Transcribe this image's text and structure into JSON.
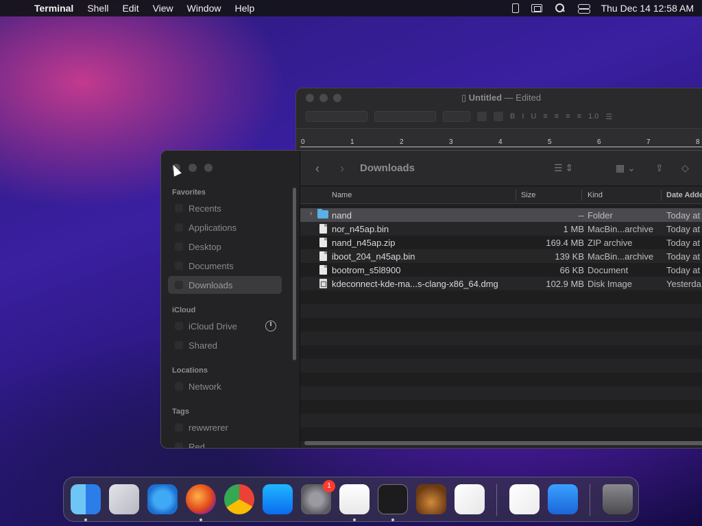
{
  "menubar": {
    "app_name": "Terminal",
    "items": [
      "Shell",
      "Edit",
      "View",
      "Window",
      "Help"
    ],
    "datetime": "Thu Dec 14  12:58 AM"
  },
  "textedit": {
    "title": "Untitled",
    "title_suffix": "— Edited",
    "line_spacing": "1.0",
    "ruler_numbers": [
      "0",
      "1",
      "2",
      "3",
      "4",
      "5",
      "6",
      "7",
      "8"
    ]
  },
  "finder": {
    "title": "Downloads",
    "sidebar": {
      "favorites_heading": "Favorites",
      "favorites": [
        "Recents",
        "Applications",
        "Desktop",
        "Documents",
        "Downloads"
      ],
      "icloud_heading": "iCloud",
      "icloud": [
        "iCloud Drive",
        "Shared"
      ],
      "locations_heading": "Locations",
      "locations": [
        "Network"
      ],
      "tags_heading": "Tags",
      "tags": [
        "rewwrerer",
        "Red"
      ]
    },
    "columns": {
      "name": "Name",
      "size": "Size",
      "kind": "Kind",
      "date": "Date Adde"
    },
    "files": [
      {
        "name": "nand",
        "size": "--",
        "kind": "Folder",
        "date": "Today at",
        "type": "folder"
      },
      {
        "name": "nor_n45ap.bin",
        "size": "1 MB",
        "kind": "MacBin...archive",
        "date": "Today at",
        "type": "file"
      },
      {
        "name": "nand_n45ap.zip",
        "size": "169.4 MB",
        "kind": "ZIP archive",
        "date": "Today at",
        "type": "file"
      },
      {
        "name": "iboot_204_n45ap.bin",
        "size": "139 KB",
        "kind": "MacBin...archive",
        "date": "Today at",
        "type": "file"
      },
      {
        "name": "bootrom_s5l8900",
        "size": "66 KB",
        "kind": "Document",
        "date": "Today at",
        "type": "file"
      },
      {
        "name": "kdeconnect-kde-ma...s-clang-x86_64.dmg",
        "size": "102.9 MB",
        "kind": "Disk Image",
        "date": "Yesterda",
        "type": "dmg"
      }
    ]
  },
  "dock": {
    "apps": [
      "finder",
      "launchpad",
      "safari",
      "firefox",
      "chrome",
      "app-store",
      "system-settings",
      "textedit",
      "terminal",
      "garageband",
      "vscode",
      "visual-studio",
      "weather",
      "trash"
    ],
    "system_settings_badge": "1"
  }
}
